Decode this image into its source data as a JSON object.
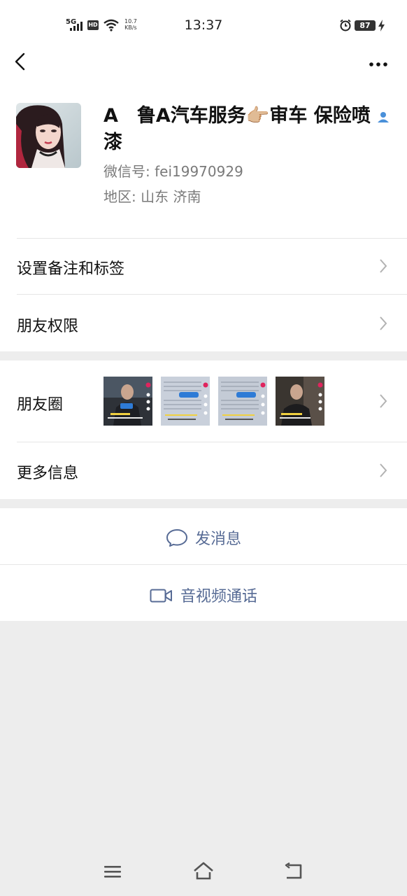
{
  "status_bar": {
    "network": "5G",
    "hd": "HD",
    "speed_value": "10.7",
    "speed_unit": "KB/s",
    "time": "13:37",
    "battery": "87"
  },
  "profile": {
    "name": "A　鲁A汽车服务👉🏼审车 保险喷漆",
    "wechat_id": "微信号:  fei19970929",
    "region": "地区:  山东  济南"
  },
  "rows": {
    "remark_label": "设置备注和标签",
    "permission_label": "朋友权限",
    "moments_label": "朋友圈",
    "more_info_label": "更多信息"
  },
  "actions": {
    "message_label": "发消息",
    "call_label": "音视频通话"
  },
  "colors": {
    "link": "#576b95",
    "background": "#ededed",
    "muted_text": "#7a7a7a"
  }
}
